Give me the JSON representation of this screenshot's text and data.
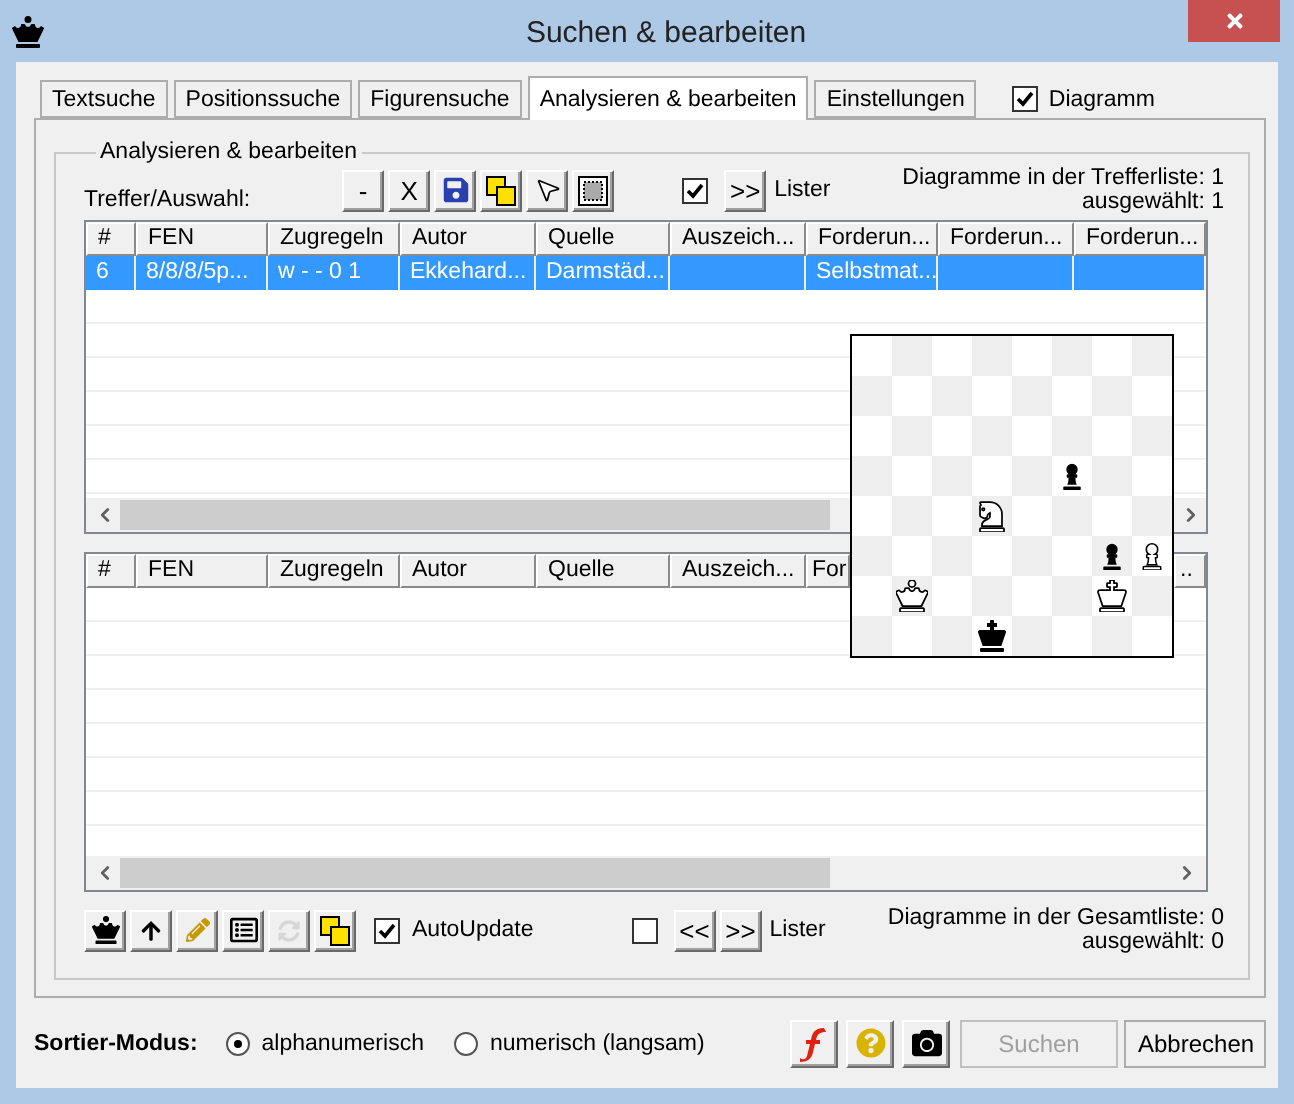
{
  "window": {
    "title": "Suchen & bearbeiten"
  },
  "tabs": [
    {
      "label": "Textsuche",
      "selected": false
    },
    {
      "label": "Positionssuche",
      "selected": false
    },
    {
      "label": "Figurensuche",
      "selected": false
    },
    {
      "label": "Analysieren & bearbeiten",
      "selected": true
    },
    {
      "label": "Einstellungen",
      "selected": false
    }
  ],
  "diagram_toggle": {
    "label": "Diagramm",
    "checked": true
  },
  "group": {
    "title": "Analysieren & bearbeiten",
    "hits_label": "Treffer/Auswahl:",
    "toolbar": [
      {
        "kind": "text",
        "label": "-",
        "disabled": false
      },
      {
        "kind": "text",
        "label": "X",
        "disabled": false
      },
      {
        "kind": "save",
        "disabled": false
      },
      {
        "kind": "copy",
        "disabled": false
      },
      {
        "kind": "pointer",
        "disabled": false
      },
      {
        "kind": "frame",
        "disabled": false
      }
    ],
    "top_lister": {
      "checked": true,
      "buttons": [
        ">>"
      ],
      "label": "Lister"
    },
    "hit_count": "Diagramme in der Trefferliste: 1",
    "hit_selected": "ausgewählt: 1",
    "hit_table": {
      "columns": [
        "#",
        "FEN",
        "Zugregeln",
        "Autor",
        "Quelle",
        "Auszeich...",
        "Forderun...",
        "Forderun...",
        "Forderun..."
      ],
      "rows": [
        {
          "selected": true,
          "cells": [
            "6",
            "8/8/8/5p...",
            "w - - 0 1",
            "Ekkehard...",
            "Darmstäd...",
            null,
            "Selbstmat...",
            null,
            null
          ]
        }
      ]
    },
    "all_table": {
      "columns": [
        "#",
        "FEN",
        "Zugregeln",
        "Autor",
        "Quelle",
        "Auszeich...",
        "For",
        ".."
      ]
    },
    "bottom_toolbar": [
      {
        "kind": "crown",
        "disabled": false
      },
      {
        "kind": "up",
        "disabled": false
      },
      {
        "kind": "pencil",
        "disabled": false
      },
      {
        "kind": "form",
        "disabled": false
      },
      {
        "kind": "refresh",
        "disabled": true
      },
      {
        "kind": "copy",
        "disabled": false
      }
    ],
    "auto_update": {
      "label": "AutoUpdate",
      "checked": true
    },
    "bottom_lister": {
      "checked": false,
      "buttons": [
        "<<",
        ">>"
      ],
      "label": "Lister"
    },
    "total_count": "Diagramme in der Gesamtliste: 0",
    "total_selected": "ausgewählt: 0"
  },
  "diagram": {
    "ranks": [
      [
        {
          "kind": "empty"
        },
        {
          "kind": "empty"
        },
        {
          "kind": "empty"
        },
        {
          "kind": "empty"
        },
        {
          "kind": "empty"
        },
        {
          "kind": "empty"
        },
        {
          "kind": "empty"
        },
        {
          "kind": "empty"
        }
      ],
      [
        {
          "kind": "empty"
        },
        {
          "kind": "empty"
        },
        {
          "kind": "empty"
        },
        {
          "kind": "empty"
        },
        {
          "kind": "empty"
        },
        {
          "kind": "empty"
        },
        {
          "kind": "empty"
        },
        {
          "kind": "empty"
        }
      ],
      [
        {
          "kind": "empty"
        },
        {
          "kind": "empty"
        },
        {
          "kind": "empty"
        },
        {
          "kind": "empty"
        },
        {
          "kind": "empty"
        },
        {
          "kind": "empty"
        },
        {
          "kind": "empty"
        },
        {
          "kind": "empty"
        }
      ],
      [
        {
          "kind": "empty"
        },
        {
          "kind": "empty"
        },
        {
          "kind": "empty"
        },
        {
          "kind": "empty"
        },
        {
          "kind": "empty"
        },
        {
          "kind": "black-pawn"
        },
        {
          "kind": "empty"
        },
        {
          "kind": "empty"
        }
      ],
      [
        {
          "kind": "empty"
        },
        {
          "kind": "empty"
        },
        {
          "kind": "empty"
        },
        {
          "kind": "white-knight"
        },
        {
          "kind": "empty"
        },
        {
          "kind": "empty"
        },
        {
          "kind": "empty"
        },
        {
          "kind": "empty"
        }
      ],
      [
        {
          "kind": "empty"
        },
        {
          "kind": "empty"
        },
        {
          "kind": "empty"
        },
        {
          "kind": "empty"
        },
        {
          "kind": "empty"
        },
        {
          "kind": "empty"
        },
        {
          "kind": "black-pawn"
        },
        {
          "kind": "white-pawn"
        }
      ],
      [
        {
          "kind": "empty"
        },
        {
          "kind": "white-queen"
        },
        {
          "kind": "empty"
        },
        {
          "kind": "empty"
        },
        {
          "kind": "empty"
        },
        {
          "kind": "empty"
        },
        {
          "kind": "white-king"
        },
        {
          "kind": "empty"
        }
      ],
      [
        {
          "kind": "empty"
        },
        {
          "kind": "empty"
        },
        {
          "kind": "empty"
        },
        {
          "kind": "black-king"
        },
        {
          "kind": "empty"
        },
        {
          "kind": "empty"
        },
        {
          "kind": "empty"
        },
        {
          "kind": "empty"
        }
      ]
    ]
  },
  "sort": {
    "label": "Sortier-Modus:",
    "options": [
      {
        "label": "alphanumerisch",
        "selected": true
      },
      {
        "label": "numerisch (langsam)",
        "selected": false
      }
    ]
  },
  "footer_tools": [
    {
      "kind": "flash"
    },
    {
      "kind": "help"
    },
    {
      "kind": "camera"
    }
  ],
  "buttons": [
    {
      "label": "Suchen",
      "disabled": true
    },
    {
      "label": "Abbrechen",
      "disabled": false
    }
  ]
}
